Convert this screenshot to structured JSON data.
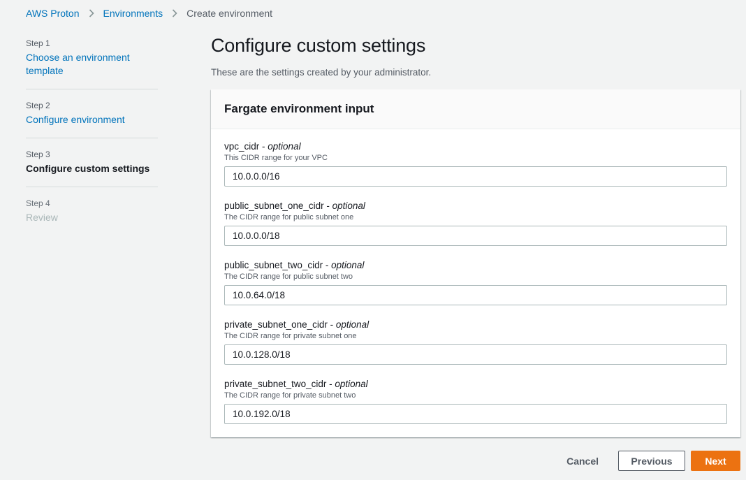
{
  "breadcrumb": {
    "items": [
      "AWS Proton",
      "Environments"
    ],
    "current": "Create environment"
  },
  "steps": [
    {
      "num": "Step 1",
      "title": "Choose an environment template"
    },
    {
      "num": "Step 2",
      "title": "Configure environment"
    },
    {
      "num": "Step 3",
      "title": "Configure custom settings"
    },
    {
      "num": "Step 4",
      "title": "Review"
    }
  ],
  "page": {
    "title": "Configure custom settings",
    "description": "These are the settings created by your administrator."
  },
  "panel": {
    "title": "Fargate environment input",
    "optional_text": "optional",
    "fields": [
      {
        "name": "vpc_cidr",
        "description": "This CIDR range for your VPC",
        "value": "10.0.0.0/16"
      },
      {
        "name": "public_subnet_one_cidr",
        "description": "The CIDR range for public subnet one",
        "value": "10.0.0.0/18"
      },
      {
        "name": "public_subnet_two_cidr",
        "description": "The CIDR range for public subnet two",
        "value": "10.0.64.0/18"
      },
      {
        "name": "private_subnet_one_cidr",
        "description": "The CIDR range for private subnet one",
        "value": "10.0.128.0/18"
      },
      {
        "name": "private_subnet_two_cidr",
        "description": "The CIDR range for private subnet two",
        "value": "10.0.192.0/18"
      }
    ]
  },
  "actions": {
    "cancel": "Cancel",
    "previous": "Previous",
    "next": "Next"
  },
  "colors": {
    "link": "#0073bb",
    "primary": "#ec7211",
    "background": "#f2f3f3"
  },
  "icons": {
    "breadcrumb_separator": "chevron-right-icon"
  }
}
